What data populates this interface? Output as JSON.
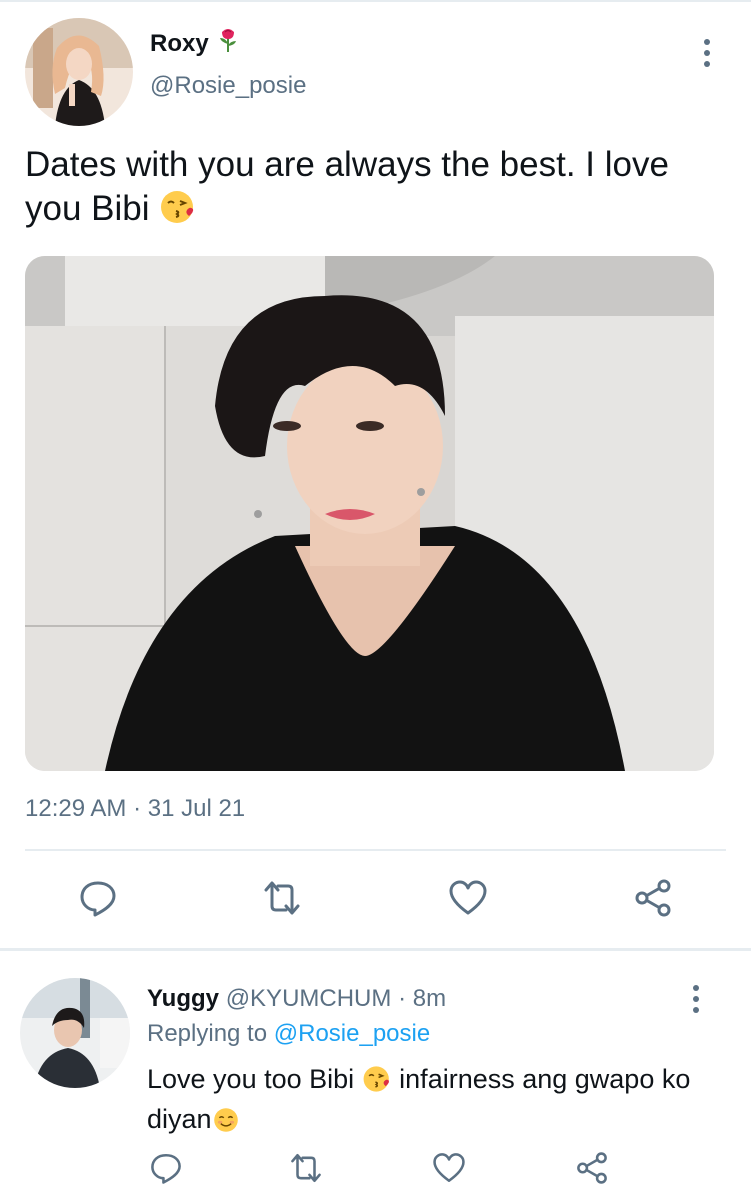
{
  "main_tweet": {
    "display_name": "Roxy",
    "name_emoji_icon": "rose-icon",
    "handle": "@Rosie_posie",
    "text": "Dates with you are always the best. I love you Bibi",
    "text_emoji_icon": "face-blowing-kiss-icon",
    "timestamp": "12:29 AM · 31 Jul 21",
    "media_description_icon": "photo"
  },
  "actions": {
    "reply_icon": "reply-icon",
    "retweet_icon": "retweet-icon",
    "like_icon": "heart-icon",
    "share_icon": "share-icon"
  },
  "reply_tweet": {
    "display_name": "Yuggy",
    "handle": "@KYUMCHUM",
    "separator": "·",
    "time": "8m",
    "replying_prefix": "Replying to",
    "replying_mention": "@Rosie_posie",
    "text_part1": "Love you too Bibi",
    "text_part2": "infairness ang gwapo ko diyan",
    "emoji1_icon": "face-blowing-kiss-icon",
    "emoji2_icon": "smiling-face-icon"
  },
  "colors": {
    "text_primary": "#0f1419",
    "text_secondary": "#5b7083",
    "link": "#1da1f2",
    "divider": "#e6ecf0"
  }
}
